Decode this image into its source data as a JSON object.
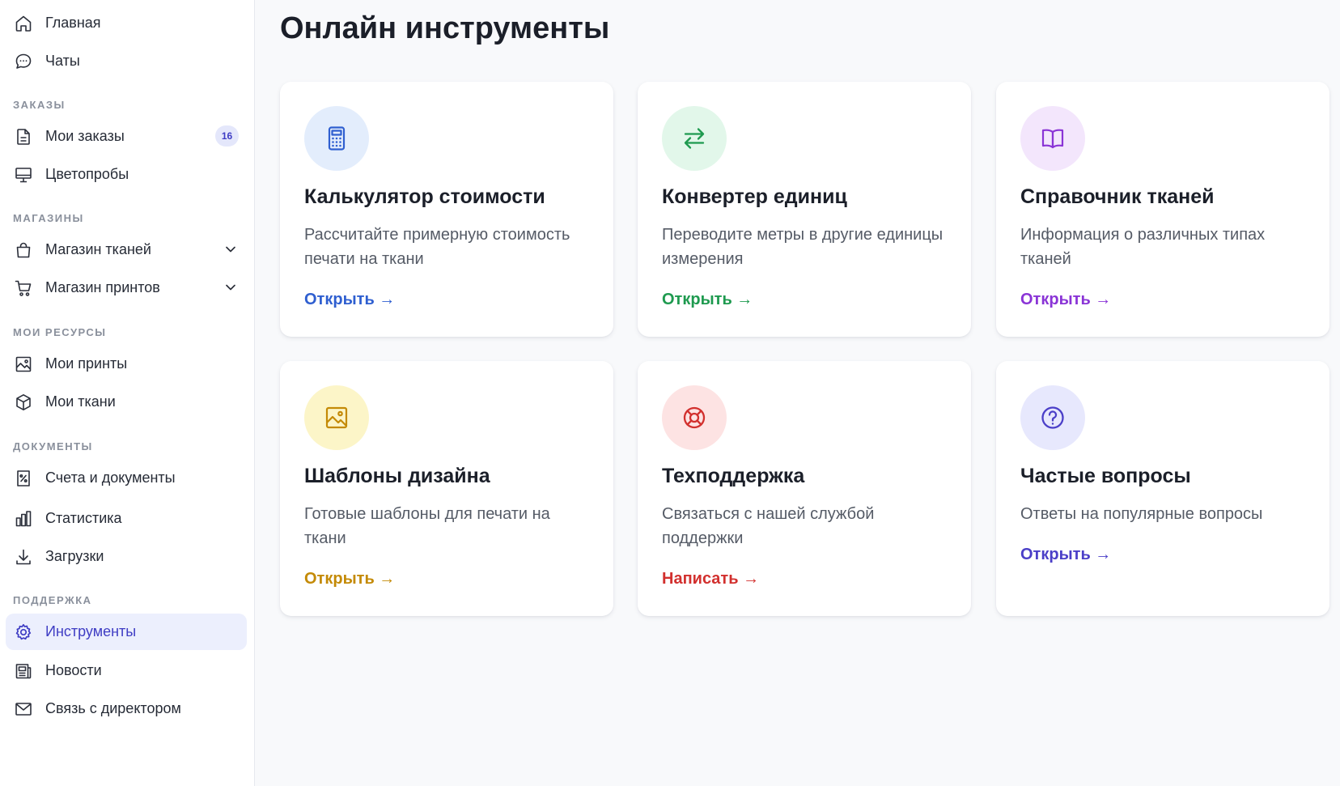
{
  "sidebar": {
    "items": [
      {
        "label": "Главная"
      },
      {
        "label": "Чаты"
      },
      {
        "label": "Мои заказы",
        "badge": "16"
      },
      {
        "label": "Цветопробы"
      },
      {
        "label": "Магазин тканей"
      },
      {
        "label": "Магазин принтов"
      },
      {
        "label": "Мои принты"
      },
      {
        "label": "Мои ткани"
      },
      {
        "label": "Счета и документы"
      },
      {
        "label": "Статистика"
      },
      {
        "label": "Загрузки"
      },
      {
        "label": "Инструменты",
        "active": true
      },
      {
        "label": "Новости"
      },
      {
        "label": "Связь с директором"
      }
    ],
    "sections": {
      "orders": "ЗАКАЗЫ",
      "shops": "МАГАЗИНЫ",
      "resources": "МОИ РЕСУРСЫ",
      "documents": "ДОКУМЕНТЫ",
      "support": "ПОДДЕРЖКА"
    }
  },
  "main": {
    "title": "Онлайн инструменты",
    "cards": [
      {
        "title": "Калькулятор стоимости",
        "description": "Рассчитайте примерную стоимость печати на ткани",
        "link": "Открыть →",
        "icon": "calculator-icon",
        "accent": "#2f5fd0",
        "bg": "#e3edfc"
      },
      {
        "title": "Конвертер единиц",
        "description": "Переводите метры в другие единицы измерения",
        "link": "Открыть →",
        "icon": "swap-arrows-icon",
        "accent": "#1e9a4f",
        "bg": "#e2f7ea"
      },
      {
        "title": "Справочник тканей",
        "description": "Информация о различных типах тканей",
        "link": "Открыть →",
        "icon": "book-icon",
        "accent": "#8a34d6",
        "bg": "#f3e6fc"
      },
      {
        "title": "Шаблоны дизайна",
        "description": "Готовые шаблоны для печати на ткани",
        "link": "Открыть →",
        "icon": "image-icon",
        "accent": "#c48a06",
        "bg": "#fcf5c8"
      },
      {
        "title": "Техподдержка",
        "description": "Связаться с нашей службой поддержки",
        "link": "Написать →",
        "icon": "lifebuoy-icon",
        "accent": "#d2302e",
        "bg": "#fde3e3"
      },
      {
        "title": "Частые вопросы",
        "description": "Ответы на популярные вопросы",
        "link": "Открыть →",
        "icon": "question-icon",
        "accent": "#4b3fc8",
        "bg": "#e7e8fd"
      }
    ]
  }
}
